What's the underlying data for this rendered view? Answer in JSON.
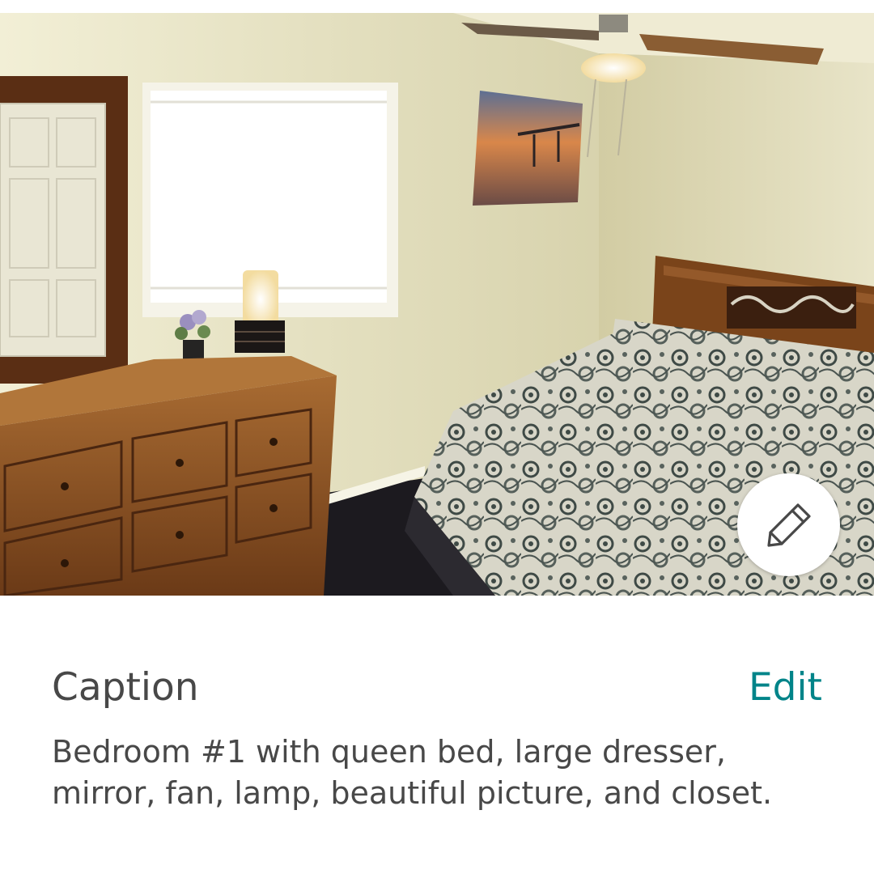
{
  "photo": {
    "edit_icon": "pencil-icon"
  },
  "caption": {
    "title": "Caption",
    "edit_label": "Edit",
    "text": "Bedroom #1 with queen bed, large dresser, mirror, fan, lamp, beautiful picture, and closet."
  },
  "colors": {
    "accent": "#008489",
    "text": "#484848",
    "background": "#ffffff"
  }
}
